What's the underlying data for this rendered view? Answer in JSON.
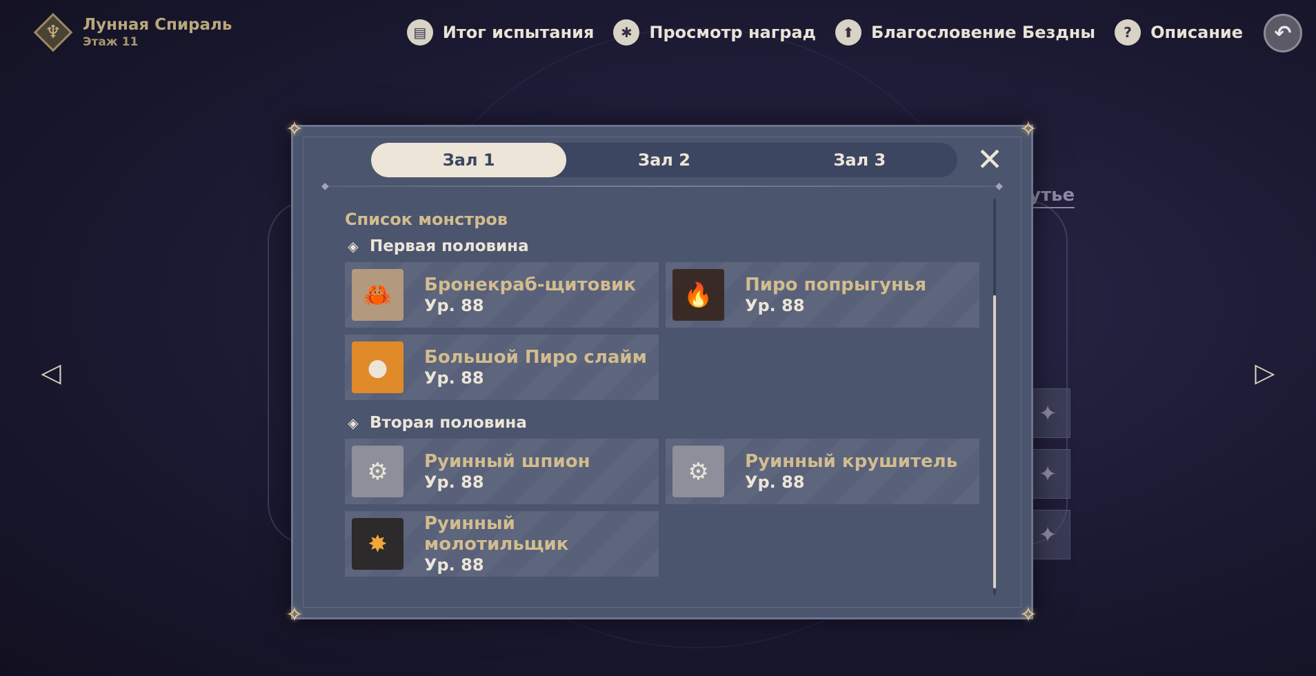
{
  "header": {
    "title": "Лунная Спираль",
    "subtitle": "Этаж 11"
  },
  "top_menu": [
    {
      "label": "Итог испытания",
      "icon": "book-icon"
    },
    {
      "label": "Просмотр наград",
      "icon": "star-badge-icon"
    },
    {
      "label": "Благословение Бездны",
      "icon": "upload-arrow-icon"
    },
    {
      "label": "Описание",
      "icon": "question-icon"
    }
  ],
  "background": {
    "partial_heading": "утье"
  },
  "dialog": {
    "tabs": [
      {
        "label": "Зал 1",
        "active": true
      },
      {
        "label": "Зал 2",
        "active": false
      },
      {
        "label": "Зал 3",
        "active": false
      }
    ],
    "section_title": "Список монстров",
    "halves": [
      {
        "label": "Первая половина",
        "monsters": [
          {
            "name": "Бронекраб-щитовик",
            "level": "Ур. 88",
            "icon": "crab-icon"
          },
          {
            "name": "Пиро попрыгунья",
            "level": "Ур. 88",
            "icon": "abyss-flame-icon"
          },
          {
            "name": "Большой Пиро слайм",
            "level": "Ур. 88",
            "icon": "slime-icon"
          }
        ]
      },
      {
        "label": "Вторая половина",
        "monsters": [
          {
            "name": "Руинный шпион",
            "level": "Ур. 88",
            "icon": "ruin-spy-icon"
          },
          {
            "name": "Руинный крушитель",
            "level": "Ур. 88",
            "icon": "ruin-destroyer-icon"
          },
          {
            "name": "Руинный молотильщик",
            "level": "Ур. 88",
            "icon": "ruin-grader-icon"
          }
        ]
      }
    ]
  },
  "colors": {
    "gold": "#d3bc8e",
    "cream": "#ece5d8",
    "panel": "#4c556e",
    "card": "#586179"
  }
}
